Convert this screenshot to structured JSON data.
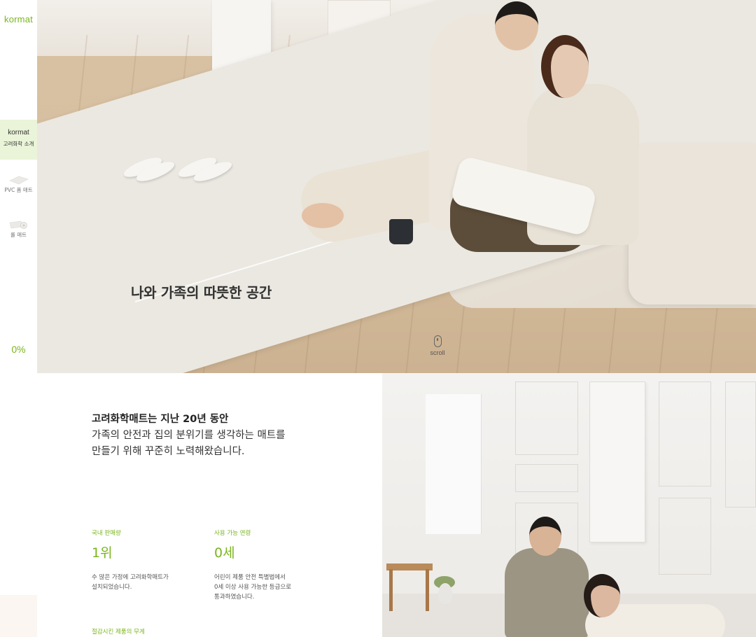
{
  "sidebar": {
    "logo": "kormat",
    "nav_active": {
      "title": "kormat",
      "subtitle": "고려화학 소개"
    },
    "nav_items": [
      {
        "label": "PVC 폼 매트"
      },
      {
        "label": "롤 매트"
      }
    ],
    "progress": "0%"
  },
  "hero": {
    "title": "나와 가족의 따뜻한 공간",
    "scroll_label": "scroll"
  },
  "intro": {
    "line1": "고려화학매트는 지난 20년 동안",
    "line2": "가족의 안전과 집의 분위기를 생각하는 매트를",
    "line3": "만들기 위해 꾸준히 노력해왔습니다."
  },
  "stats": [
    {
      "caption": "국내 판매량",
      "value": "1위",
      "desc": [
        "수 많은 가정에 고려화학매트가",
        "설치되었습니다."
      ]
    },
    {
      "caption": "사용 가능 연령",
      "value": "0세",
      "desc": [
        "어린이 제품 안전 특별법에서",
        "0세 이상 사용 가능한 등급으로",
        "통과하였습니다."
      ]
    }
  ],
  "stat3_caption": "절감시킨 제품의 무게",
  "colors": {
    "accent": "#7ab51d",
    "nav_active_bg": "#eaf4d8"
  }
}
